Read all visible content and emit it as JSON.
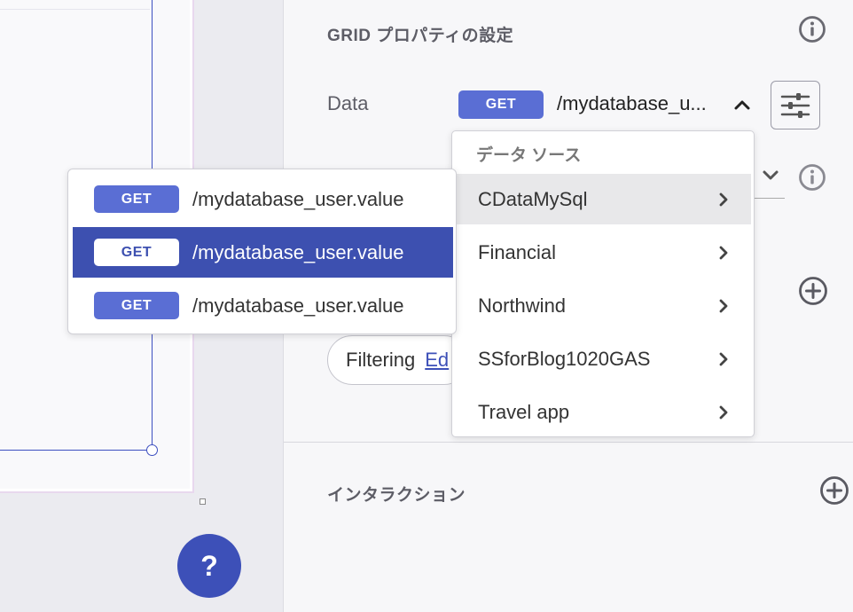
{
  "panel": {
    "title": "GRID プロパティの設定",
    "data_label": "Data",
    "data_method": "GET",
    "data_value": "/mydatabase_u...",
    "filter_chip": {
      "label": "Filtering",
      "link": "Ed"
    },
    "interaction_title": "インタラクション"
  },
  "source_dropdown": {
    "heading": "データ ソース",
    "items": [
      {
        "label": "CDataMySql",
        "active": true
      },
      {
        "label": "Financial"
      },
      {
        "label": "Northwind"
      },
      {
        "label": "SSforBlog1020GAS"
      },
      {
        "label": "Travel app"
      }
    ]
  },
  "endpoints": [
    {
      "method": "GET",
      "path": "/mydatabase_user.value"
    },
    {
      "method": "GET",
      "path": "/mydatabase_user.value",
      "selected": true
    },
    {
      "method": "GET",
      "path": "/mydatabase_user.value"
    }
  ],
  "help": {
    "label": "?"
  },
  "colors": {
    "accent": "#3d50b8",
    "badge": "#5a6ed4",
    "selected_row": "#3d50b0"
  },
  "icons": {
    "info": "info-icon",
    "chevron_up": "chevron-up-icon",
    "chevron_down": "chevron-down-icon",
    "chevron_right": "chevron-right-icon",
    "settings": "sliders-icon",
    "add": "plus-circle-icon",
    "help": "question-icon"
  }
}
